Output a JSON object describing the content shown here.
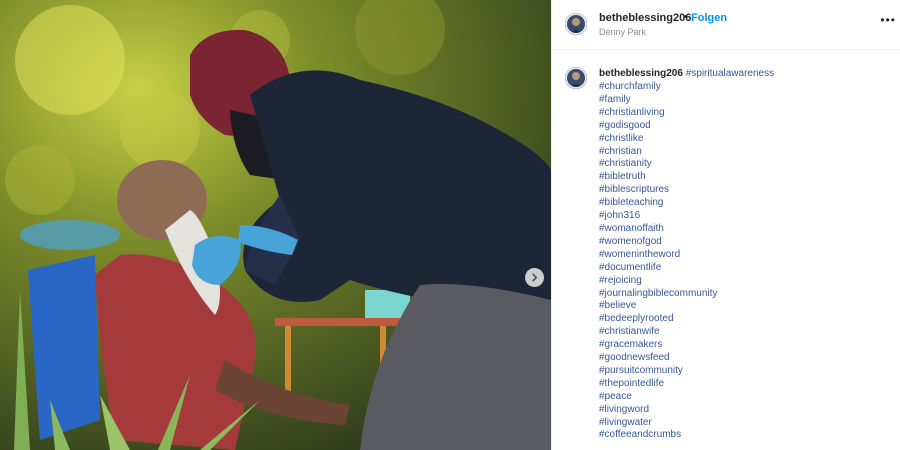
{
  "post": {
    "username": "betheblessing206",
    "follow_label": "Folgen",
    "separator": "•",
    "location": "Denny Park",
    "more_label": "•••",
    "caption_first_tag": "#spiritualawareness",
    "hashtags": [
      "#churchfamily",
      "#family",
      "#christianliving",
      "#godisgood",
      "#christlike",
      "#christian",
      "#christianity",
      "#bibletruth",
      "#biblescriptures",
      "#bibleteaching",
      "#john316",
      "#womanoffaith",
      "#womenofgod",
      "#womenintheword",
      "#documentlife",
      "#rejoicing",
      "#journalingbiblecommunity",
      "#believe",
      "#bedeeplyrooted",
      "#christianwife",
      "#gracemakers",
      "#goodnewsfeed",
      "#pursuitcommunity",
      "#thepointedlife",
      "#peace",
      "#livingword",
      "#livingwater",
      "#coffeeandcrumbs"
    ]
  },
  "colors": {
    "link": "#0095f6",
    "hashtag": "#385898"
  },
  "icons": {
    "next": "chevron-right-icon",
    "more": "more-options-icon"
  }
}
